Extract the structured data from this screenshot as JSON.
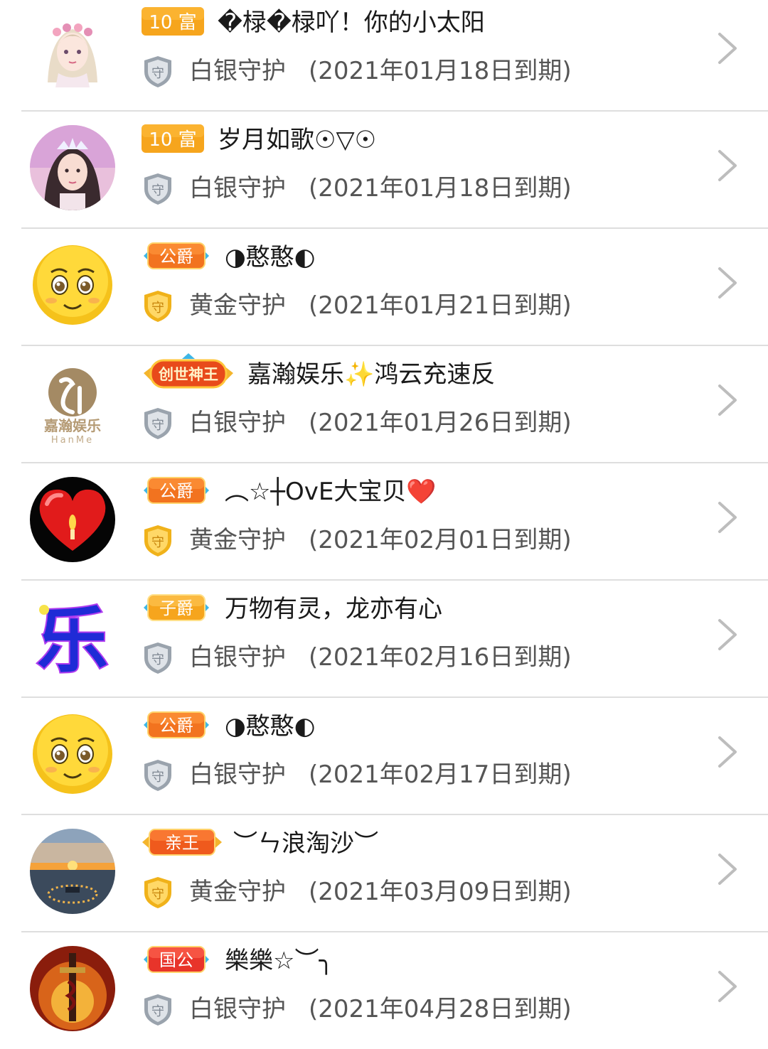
{
  "accent_colors": {
    "rich_badge": "#f6a51d",
    "noble_badge": "#f2731f",
    "silver_shield": "#9aa3ad",
    "gold_shield": "#f0b21a",
    "divider": "#dedede",
    "chevron": "#bdbdbd"
  },
  "guards": [
    {
      "badge_text": "10 富",
      "badge_type": "rich",
      "name": "�椂�椂吖！你的小太阳",
      "tier": "白银守护",
      "tier_type": "silver",
      "expiry": "(2021年01月18日到期)",
      "avatar_icon": "anime-girl-avatar"
    },
    {
      "badge_text": "10 富",
      "badge_type": "rich",
      "name": "岁月如歌☉▽☉",
      "tier": "白银守护",
      "tier_type": "silver",
      "expiry": "(2021年01月18日到期)",
      "avatar_icon": "girl-photo-avatar"
    },
    {
      "badge_text": "公爵",
      "badge_type": "noble",
      "name": "◑憨憨◐",
      "tier": "黄金守护",
      "tier_type": "gold",
      "expiry": "(2021年01月21日到期)",
      "avatar_icon": "smiley-face-avatar"
    },
    {
      "badge_text": "创世神王",
      "badge_type": "crown",
      "name": "嘉瀚娱乐✨鸿云充速反",
      "tier": "白银守护",
      "tier_type": "silver",
      "expiry": "(2021年01月26日到期)",
      "avatar_icon": "logo-avatar",
      "avatar_logo_text": "嘉瀚娱乐",
      "avatar_logo_sub": "HanMe"
    },
    {
      "badge_text": "公爵",
      "badge_type": "noble",
      "name": "︵☆┼OvE大宝贝❤️",
      "tier": "黄金守护",
      "tier_type": "gold",
      "expiry": "(2021年02月01日到期)",
      "avatar_icon": "red-heart-avatar"
    },
    {
      "badge_text": "子爵",
      "badge_type": "noble",
      "name": "万物有灵，龙亦有心",
      "tier": "白银守护",
      "tier_type": "silver",
      "expiry": "(2021年02月16日到期)",
      "avatar_icon": "le-character-avatar",
      "avatar_char": "乐"
    },
    {
      "badge_text": "公爵",
      "badge_type": "noble",
      "name": "◑憨憨◐",
      "tier": "白银守护",
      "tier_type": "silver",
      "expiry": "(2021年02月17日到期)",
      "avatar_icon": "smiley-face-avatar"
    },
    {
      "badge_text": "亲王",
      "badge_type": "prince",
      "name": "︶ㄣ浪淘沙︶",
      "tier": "黄金守护",
      "tier_type": "gold",
      "expiry": "(2021年03月09日到期)",
      "avatar_icon": "sunset-avatar"
    },
    {
      "badge_text": "国公",
      "badge_type": "noble",
      "name": "樂樂☆︶╮",
      "tier": "白银守护",
      "tier_type": "silver",
      "expiry": "(2021年04月28日到期)",
      "avatar_icon": "sword-fire-avatar"
    }
  ]
}
